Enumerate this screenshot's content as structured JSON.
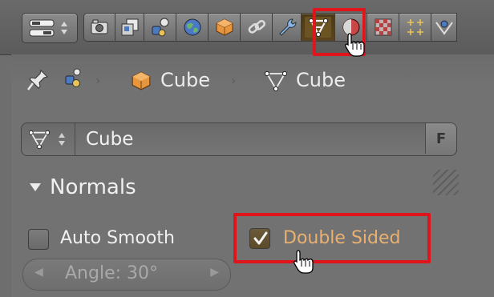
{
  "colors": {
    "highlight": "#e0141b",
    "checked_label": "#e9b070",
    "panel_bg": "#727272"
  },
  "header": {
    "editor_type_icon": "editor-type-icon",
    "context_tabs": [
      {
        "icon": "render-icon"
      },
      {
        "icon": "render-layers-icon"
      },
      {
        "icon": "scene-icon"
      },
      {
        "icon": "world-icon"
      },
      {
        "icon": "object-icon"
      },
      {
        "icon": "constraints-icon"
      },
      {
        "icon": "modifiers-icon"
      },
      {
        "icon": "mesh-data-icon",
        "active": true
      },
      {
        "icon": "material-icon"
      },
      {
        "icon": "texture-icon"
      },
      {
        "icon": "particles-icon"
      },
      {
        "icon": "physics-icon"
      }
    ]
  },
  "breadcrumb": {
    "object_name": "Cube",
    "mesh_name": "Cube"
  },
  "datablock": {
    "name": "Cube",
    "fake_user_label": "F"
  },
  "normals_panel": {
    "title": "Normals",
    "auto_smooth_label": "Auto Smooth",
    "auto_smooth_checked": false,
    "double_sided_label": "Double Sided",
    "double_sided_checked": true,
    "angle_label": "Angle: 30°"
  }
}
